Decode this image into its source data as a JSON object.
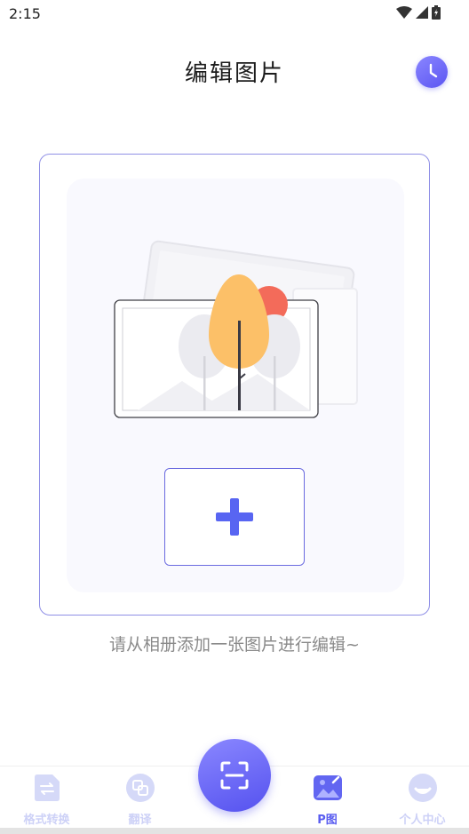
{
  "status_bar": {
    "time": "2:15"
  },
  "header": {
    "title": "编辑图片"
  },
  "editor": {
    "hint": "请从相册添加一张图片进行编辑~"
  },
  "tabs": [
    {
      "label": "格式转换",
      "icon": "format-convert-icon",
      "active": false
    },
    {
      "label": "翻译",
      "icon": "translate-icon",
      "active": false
    },
    {
      "label": "P图",
      "icon": "photo-edit-icon",
      "active": true
    },
    {
      "label": "个人中心",
      "icon": "profile-icon",
      "active": false
    }
  ],
  "fab": {
    "icon": "scan-icon"
  },
  "colors": {
    "accent": "#5a5df0",
    "inactive_tab": "#cdd1f7",
    "frame_border": "#8f8fe6"
  }
}
